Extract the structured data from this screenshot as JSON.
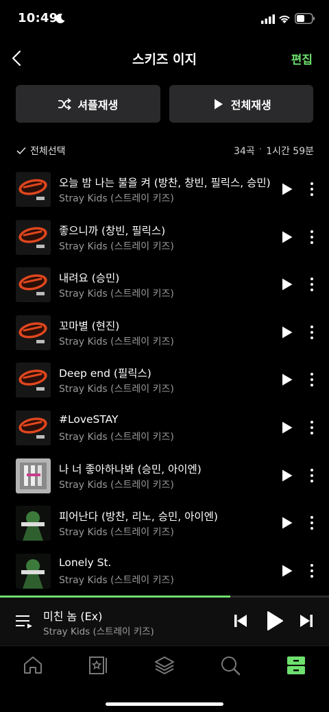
{
  "status_bar": {
    "time": "10:49"
  },
  "nav": {
    "title": "스키즈 이지",
    "edit_label": "편집"
  },
  "actions": {
    "shuffle_label": "셔플재생",
    "play_all_label": "전체재생"
  },
  "list_header": {
    "select_all_label": "전체선택",
    "track_count": "34곡",
    "separator": "·",
    "duration": "1시간 59분"
  },
  "tracks": [
    {
      "title": "오늘 밤 나는 불을 켜 (방찬, 창빈, 필릭스, 승민)",
      "artist": "Stray Kids (스트레이 키즈)",
      "art": "red"
    },
    {
      "title": "좋으니까 (창빈, 필릭스)",
      "artist": "Stray Kids (스트레이 키즈)",
      "art": "red"
    },
    {
      "title": "내려요 (승민)",
      "artist": "Stray Kids (스트레이 키즈)",
      "art": "red"
    },
    {
      "title": "꼬마별 (현진)",
      "artist": "Stray Kids (스트레이 키즈)",
      "art": "red"
    },
    {
      "title": "Deep end (필릭스)",
      "artist": "Stray Kids (스트레이 키즈)",
      "art": "red"
    },
    {
      "title": "#LoveSTAY",
      "artist": "Stray Kids (스트레이 키즈)",
      "art": "red"
    },
    {
      "title": "나 너 좋아하나봐 (승민, 아이엔)",
      "artist": "Stray Kids (스트레이 키즈)",
      "art": "gray"
    },
    {
      "title": "피어난다 (방찬, 리노, 승민, 아이엔)",
      "artist": "Stray Kids (스트레이 키즈)",
      "art": "green"
    },
    {
      "title": "Lonely St.",
      "artist": "Stray Kids (스트레이 키즈)",
      "art": "green"
    }
  ],
  "now_playing": {
    "title": "미친 놈 (Ex)",
    "artist": "Stray Kids (스트레이 키즈)",
    "progress": 0.7
  },
  "tabs": [
    "home-icon",
    "star-book-icon",
    "layers-icon",
    "search-icon",
    "library-icon"
  ],
  "colors": {
    "accent": "#6ee06e",
    "button_bg": "#2a2a2c"
  }
}
